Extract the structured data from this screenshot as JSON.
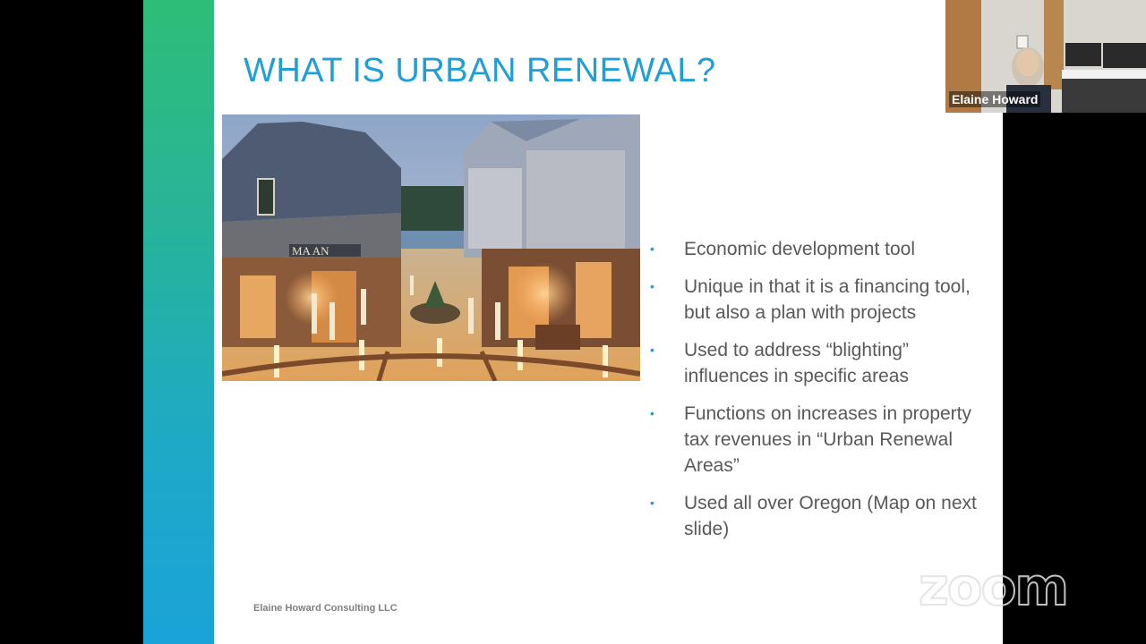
{
  "slide": {
    "title": "WHAT IS URBAN RENEWAL?",
    "photo_sign": "MA AN",
    "bullets": [
      {
        "icon": "bullet-dot",
        "text": "Economic development tool"
      },
      {
        "icon": "bullet-dot",
        "text": "Unique in that it is a financing tool, but also a plan with projects"
      },
      {
        "icon": "bullet-dot",
        "text": "Used to address “blighting” influences in specific areas"
      },
      {
        "icon": "bullet-dot",
        "text": "Functions on increases in property tax revenues in “Urban Renewal Areas”"
      },
      {
        "icon": "bullet-dot",
        "text": "Used all over Oregon (Map on next slide)"
      }
    ],
    "bullet_symbol": "•",
    "footer": "Elaine Howard Consulting LLC",
    "colors": {
      "title": "#1f9fd6",
      "body_text": "#595959",
      "accent_top": "#2ebd78",
      "accent_bottom": "#1aa3d8"
    }
  },
  "participant": {
    "name": "Elaine Howard"
  },
  "watermark": {
    "text": "zoom"
  }
}
